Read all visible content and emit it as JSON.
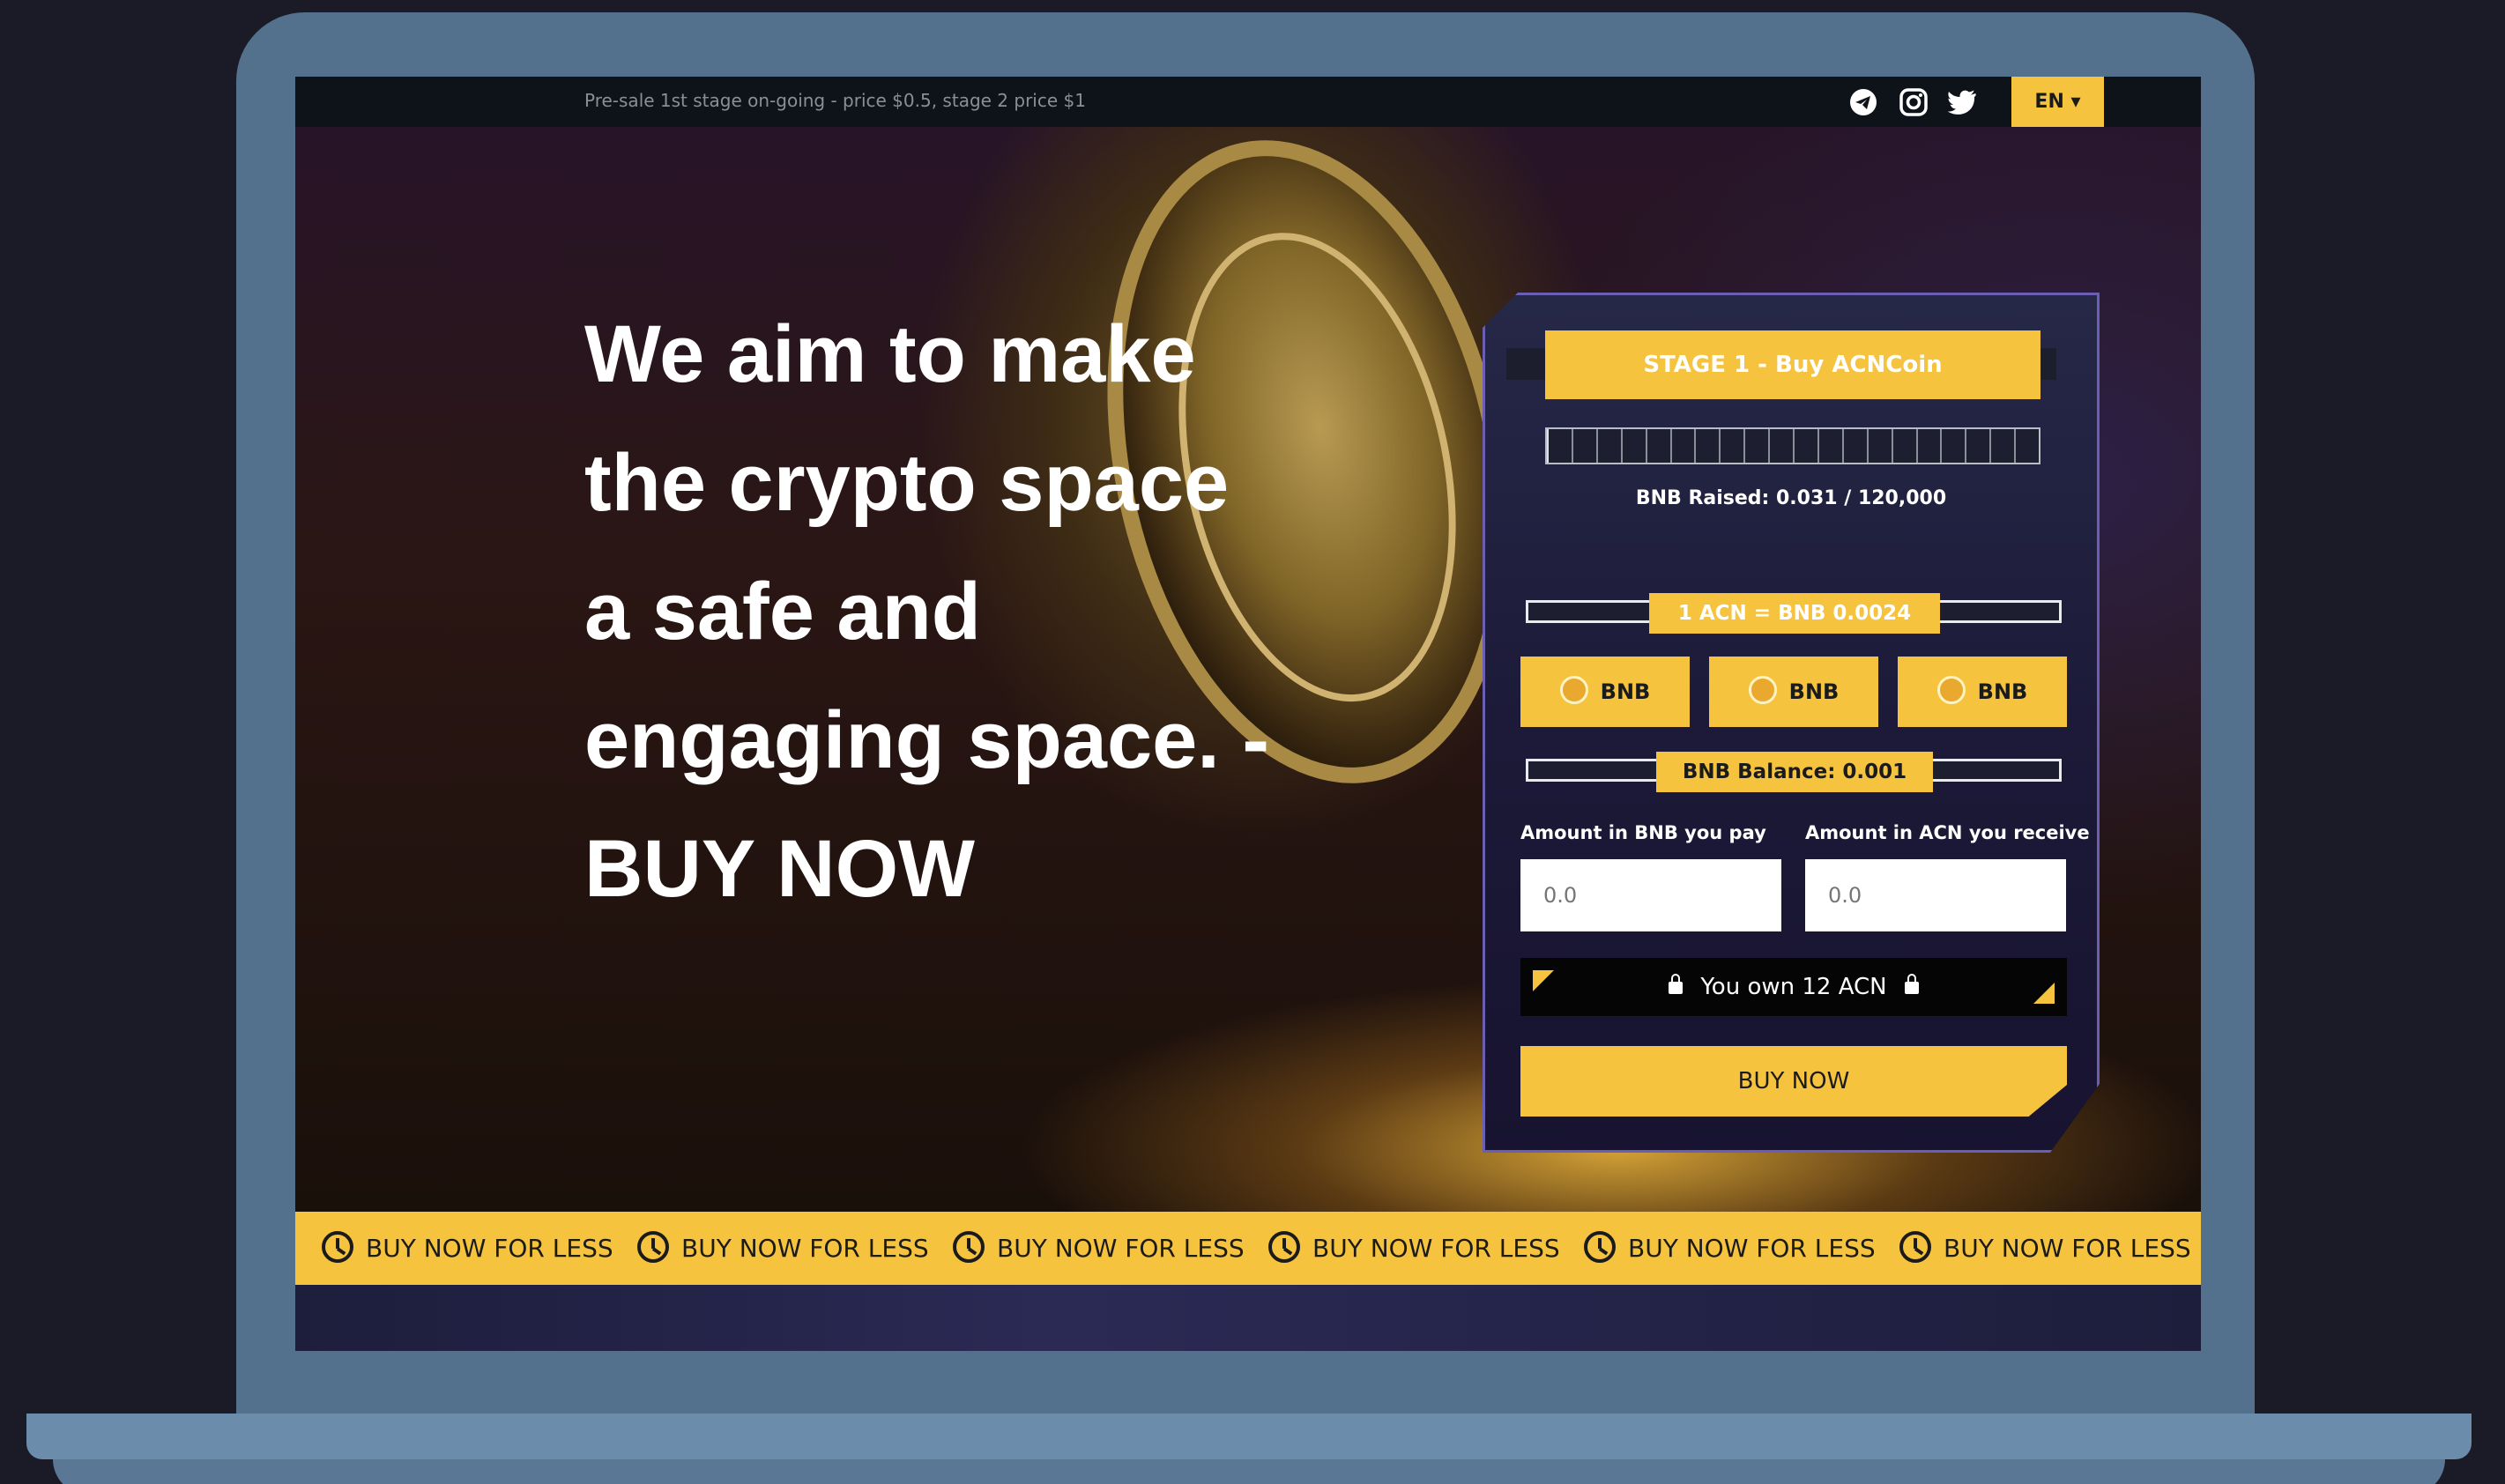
{
  "topbar": {
    "message": "Pre-sale 1st stage on-going - price $0.5, stage 2 price $1",
    "social_icons": [
      "telegram-icon",
      "instagram-icon",
      "twitter-icon"
    ],
    "language": "EN ▾"
  },
  "hero": {
    "headline_lines": [
      "We aim to make",
      "the crypto space",
      "a safe and",
      "engaging space. -",
      "BUY NOW"
    ]
  },
  "presale": {
    "stage_label": "STAGE 1 - Buy ACNCoin",
    "progress_fraction": 0.0,
    "raised_text": "BNB Raised:  0.031 /  120,000",
    "rate_text": "1 ACN = BNB 0.0024",
    "currency_buttons": [
      "BNB",
      "BNB",
      "BNB"
    ],
    "balance_text": "BNB Balance: 0.001",
    "pay_label": "Amount in BNB you pay",
    "receive_label": "Amount in ACN you receive",
    "pay_placeholder": "0.0",
    "receive_placeholder": "0.0",
    "owned_text": "You own 12 ACN",
    "buy_label": "BUY NOW"
  },
  "ticker": {
    "items": [
      "BUY NOW FOR LESS",
      "BUY NOW FOR LESS",
      "BUY NOW FOR LESS",
      "BUY NOW FOR LESS",
      "BUY NOW FOR LESS",
      "BUY NOW FOR LESS"
    ]
  },
  "colors": {
    "accent": "#f6c33f",
    "frame": "#53718c",
    "background": "#1b1b27"
  }
}
